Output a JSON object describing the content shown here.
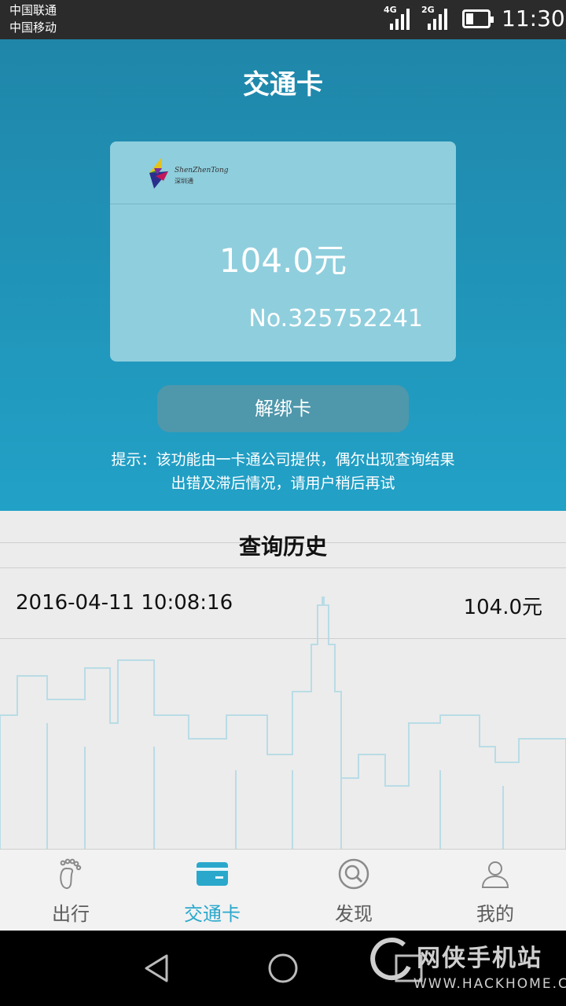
{
  "status_bar": {
    "carrier_1": "中国联通",
    "carrier_2": "中国移动",
    "network_1": "4G",
    "network_2": "2G",
    "battery_level": 0.35,
    "time": "11:30"
  },
  "header": {
    "title": "交通卡"
  },
  "card": {
    "logo_text": "ShenZhenTong",
    "logo_sub": "深圳通",
    "balance": "104.0元",
    "number": "No.325752241"
  },
  "unbind_button": {
    "label": "解绑卡"
  },
  "notice": {
    "line_1": "提示：该功能由一卡通公司提供，偶尔出现查询结果",
    "line_2": "出错及滞后情况，请用户稍后再试"
  },
  "history": {
    "title": "查询历史",
    "rows": [
      {
        "datetime": "2016-04-11 10:08:16",
        "amount": "104.0元"
      }
    ]
  },
  "tabs": [
    {
      "label": "出行",
      "icon": "footprint-icon",
      "active": false
    },
    {
      "label": "交通卡",
      "icon": "card-icon",
      "active": true
    },
    {
      "label": "发现",
      "icon": "search-icon",
      "active": false
    },
    {
      "label": "我的",
      "icon": "user-icon",
      "active": false
    }
  ],
  "watermark": {
    "text": "网侠手机站",
    "url": "WWW.HACKHOME.COM"
  },
  "colors": {
    "accent": "#2aa8cc",
    "hero_top": "#1f86a9",
    "hero_bottom": "#22a1c7",
    "card": "#8fcedd"
  }
}
